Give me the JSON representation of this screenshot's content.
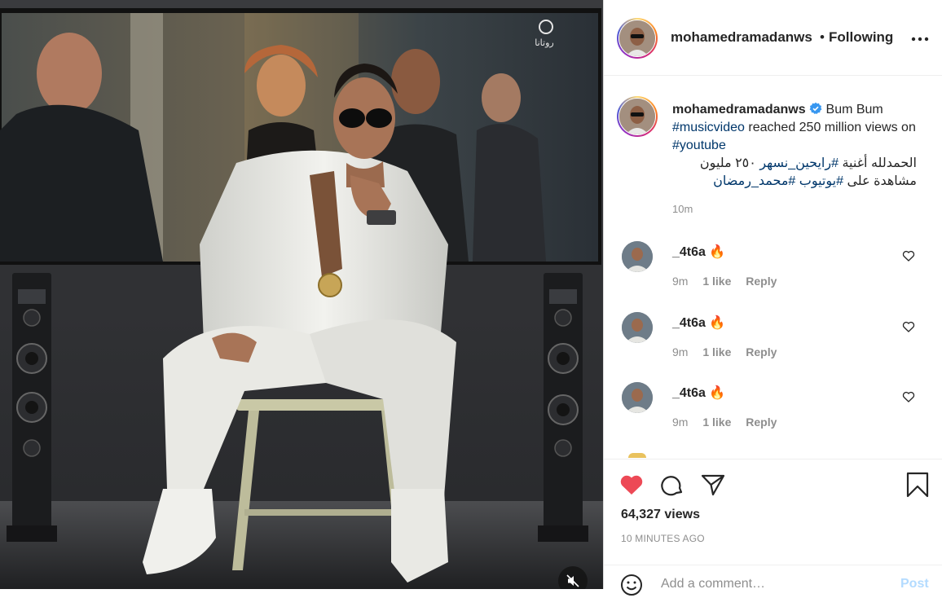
{
  "post": {
    "username": "mohamedramadanws",
    "follow_label": "Following",
    "dot": "•",
    "more_icon": "more-options-icon",
    "verified_icon": "verified-badge-icon"
  },
  "caption": {
    "username": "mohamedramadanws",
    "text_start": "Bum Bum",
    "tag1": "#musicvideo",
    "text_mid": "reached 250 million views on",
    "tag2": "#youtube",
    "arabic_line1_text": "الحمدلله أغنية",
    "arabic_tag1": "#رايحين_نسهر",
    "arabic_line1_rest": "٢٥٠ مليون",
    "arabic_line2_text": "مشاهدة على",
    "arabic_tag2": "#يوتيوب",
    "arabic_tag3": "#محمد_رمضان",
    "time": "10m"
  },
  "comments": [
    {
      "username": "_4t6a",
      "emoji": "🔥",
      "time": "9m",
      "likes": "1 like",
      "reply": "Reply"
    },
    {
      "username": "_4t6a",
      "emoji": "🔥",
      "time": "9m",
      "likes": "1 like",
      "reply": "Reply"
    },
    {
      "username": "_4t6a",
      "emoji": "🔥",
      "time": "9m",
      "likes": "1 like",
      "reply": "Reply"
    }
  ],
  "actions": {
    "like_icon": "heart-filled-icon",
    "comment_icon": "comment-icon",
    "share_icon": "share-icon",
    "save_icon": "bookmark-icon",
    "views": "64,327 views",
    "posted_ago": "10 MINUTES AGO",
    "like_color": "#ed4956"
  },
  "add_comment": {
    "placeholder": "Add a comment…",
    "post_label": "Post",
    "emoji_icon": "emoji-smiley-icon"
  },
  "media": {
    "mute_icon": "volume-muted-icon",
    "channel_logo": "روتانا"
  }
}
